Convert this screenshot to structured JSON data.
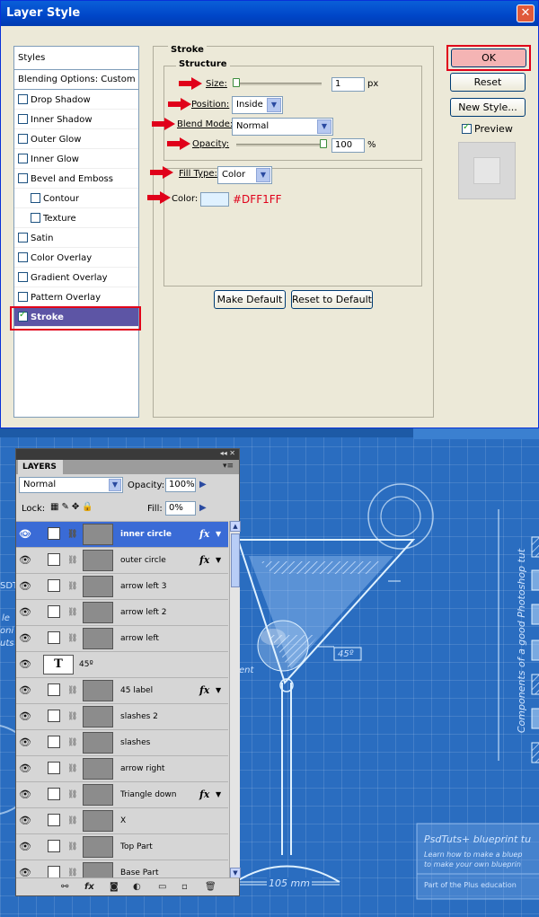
{
  "dialog": {
    "title": "Layer Style",
    "close_glyph": "✕",
    "styles_header": "Styles",
    "blending_options": "Blending Options: Custom",
    "style_items": [
      {
        "label": "Drop Shadow",
        "checked": false,
        "sub": false
      },
      {
        "label": "Inner Shadow",
        "checked": false,
        "sub": false
      },
      {
        "label": "Outer Glow",
        "checked": false,
        "sub": false
      },
      {
        "label": "Inner Glow",
        "checked": false,
        "sub": false
      },
      {
        "label": "Bevel and Emboss",
        "checked": false,
        "sub": false
      },
      {
        "label": "Contour",
        "checked": false,
        "sub": true
      },
      {
        "label": "Texture",
        "checked": false,
        "sub": true
      },
      {
        "label": "Satin",
        "checked": false,
        "sub": false
      },
      {
        "label": "Color Overlay",
        "checked": false,
        "sub": false
      },
      {
        "label": "Gradient Overlay",
        "checked": false,
        "sub": false
      },
      {
        "label": "Pattern Overlay",
        "checked": false,
        "sub": false
      },
      {
        "label": "Stroke",
        "checked": true,
        "sub": false
      }
    ],
    "stroke": {
      "group_title": "Stroke",
      "structure_title": "Structure",
      "size_label": "Size:",
      "size_value": "1",
      "size_unit": "px",
      "position_label": "Position:",
      "position_value": "Inside",
      "blend_mode_label": "Blend Mode:",
      "blend_mode_value": "Normal",
      "opacity_label": "Opacity:",
      "opacity_value": "100",
      "opacity_unit": "%",
      "fill_type_label": "Fill Type:",
      "fill_type_value": "Color",
      "color_label": "Color:",
      "color_hex": "#DFF1FF",
      "make_default": "Make Default",
      "reset_default": "Reset to Default"
    },
    "buttons": {
      "ok": "OK",
      "reset": "Reset",
      "new_style": "New Style...",
      "preview": "Preview"
    }
  },
  "layers_panel": {
    "tab": "LAYERS",
    "blend_mode": "Normal",
    "opacity_label": "Opacity:",
    "opacity_value": "100%",
    "lock_label": "Lock:",
    "fill_label": "Fill:",
    "fill_value": "0%",
    "layers": [
      {
        "name": "inner circle",
        "fx": true,
        "selected": true,
        "type": false
      },
      {
        "name": "outer circle",
        "fx": true,
        "selected": false,
        "type": false
      },
      {
        "name": "arrow left 3",
        "fx": false,
        "selected": false,
        "type": false
      },
      {
        "name": "arrow left 2",
        "fx": false,
        "selected": false,
        "type": false
      },
      {
        "name": "arrow left",
        "fx": false,
        "selected": false,
        "type": false
      },
      {
        "name": "45º",
        "fx": false,
        "selected": false,
        "type": true
      },
      {
        "name": "45 label",
        "fx": true,
        "selected": false,
        "type": false
      },
      {
        "name": "slashes 2",
        "fx": false,
        "selected": false,
        "type": false
      },
      {
        "name": "slashes",
        "fx": false,
        "selected": false,
        "type": false
      },
      {
        "name": "arrow right",
        "fx": false,
        "selected": false,
        "type": false
      },
      {
        "name": "Triangle down",
        "fx": true,
        "selected": false,
        "type": false
      },
      {
        "name": "X",
        "fx": false,
        "selected": false,
        "type": false
      },
      {
        "name": "Top Part",
        "fx": false,
        "selected": false,
        "type": false
      },
      {
        "name": "Base Part",
        "fx": false,
        "selected": false,
        "type": false
      }
    ],
    "type_glyph": "T",
    "fx_glyph": "fx"
  },
  "blueprint": {
    "angle_label": "45º",
    "vertical_text": "Components of a good Photoshop tut",
    "dimension_label": "105 mm",
    "partial_left_1": "SDT",
    "partial_left_2": "le",
    "partial_left_3": "oni",
    "partial_left_4": "uts",
    "partial_ent": "ent",
    "promo_title": "PsdTuts+ blueprint tu",
    "promo_line1": "Learn how to make a bluep",
    "promo_line2": "to make your own blueprin",
    "promo_footer": "Part of the Plus education"
  },
  "colors": {
    "titlebar": "#0046c8",
    "stroke_active": "#5d55a5",
    "highlight_red": "#e0001a",
    "blueprint_bg": "#2a6dc0",
    "selected_layer": "#3a6bd6"
  }
}
